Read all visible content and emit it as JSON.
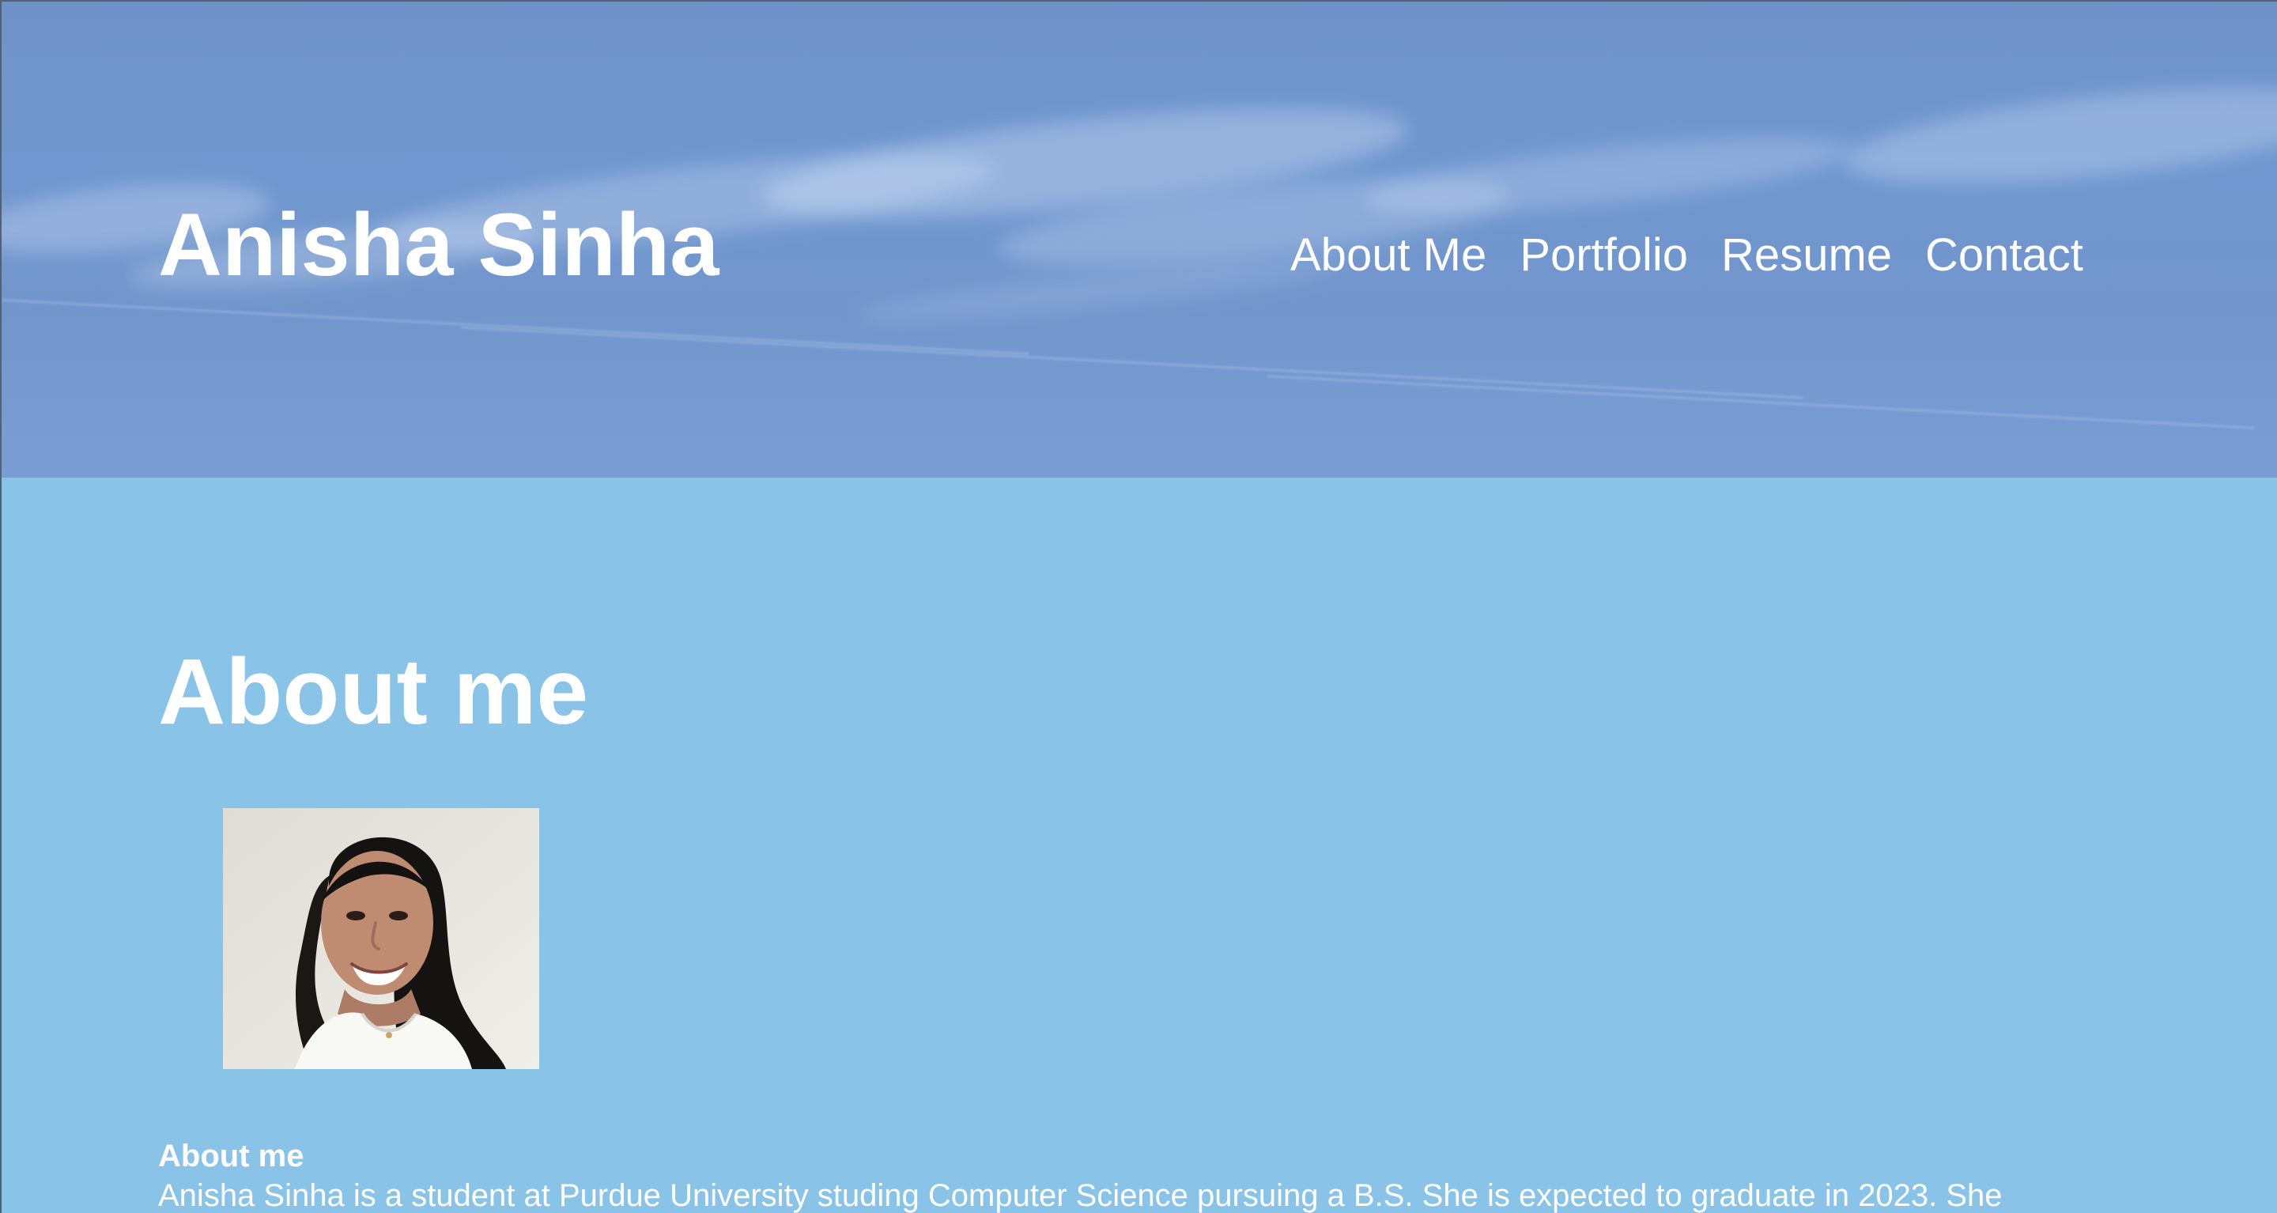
{
  "header": {
    "site_title": "Anisha Sinha",
    "nav": [
      {
        "label": "About Me"
      },
      {
        "label": "Portfolio"
      },
      {
        "label": "Resume"
      },
      {
        "label": "Contact"
      }
    ]
  },
  "main": {
    "section_title": "About me",
    "bio_heading": "About me",
    "bio_text": "Anisha Sinha is a student at Purdue University studing Computer Science pursuing a B.S. She is expected to graduate in 2023. She"
  },
  "colors": {
    "header_sky": "#7097cf",
    "main_background": "#8ac3e8",
    "text": "#ffffff"
  },
  "icons": {
    "profile_photo": "profile-photo"
  }
}
